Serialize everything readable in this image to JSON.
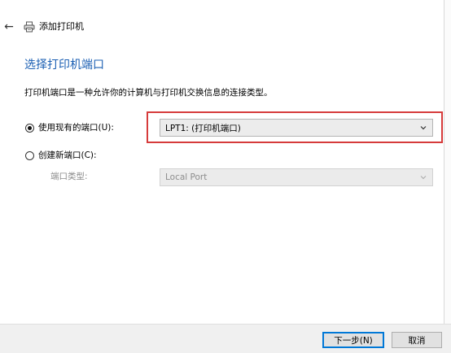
{
  "window": {
    "title": "添加打印机",
    "back_icon": "back-arrow-icon",
    "printer_icon": "printer-icon"
  },
  "page": {
    "title": "选择打印机端口",
    "description": "打印机端口是一种允许你的计算机与打印机交换信息的连接类型。"
  },
  "options": {
    "existing_port": {
      "label": "使用现有的端口(U):",
      "checked": true,
      "selected_value": "LPT1: (打印机端口)"
    },
    "new_port": {
      "label": "创建新端口(C):",
      "checked": false,
      "type_label": "端口类型:",
      "selected_value": "Local Port"
    }
  },
  "footer": {
    "next_label": "下一步(N)",
    "cancel_label": "取消"
  },
  "colors": {
    "title_blue": "#1b5fb3",
    "highlight_red": "#d63b3b",
    "accent": "#0078d7"
  }
}
